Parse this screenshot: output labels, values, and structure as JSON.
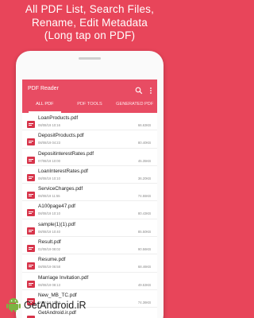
{
  "promo": {
    "line1": "All PDF List, Search Files,",
    "line2": "Rename, Edit Metadata",
    "line3": "(Long tap on PDF)"
  },
  "appbar": {
    "title": "PDF Reader",
    "icons": [
      "search-icon",
      "more-vert-icon"
    ]
  },
  "tabs": [
    {
      "label": "ALL PDF",
      "active": true
    },
    {
      "label": "PDF TOOLS",
      "active": false
    },
    {
      "label": "GENERATED PDF",
      "active": false
    }
  ],
  "files": [
    {
      "name": "LoanProducts.pdf",
      "date": "08/08/19  10:16",
      "size": "66.63KB"
    },
    {
      "name": "DepositProducts.pdf",
      "date": "08/08/19  04:23",
      "size": "80.40KB"
    },
    {
      "name": "DepositinterestRates.pdf",
      "date": "07/08/19  10:00",
      "size": "45.35KB"
    },
    {
      "name": "LoanInterestRates.pdf",
      "date": "08/08/19  10:10",
      "size": "36.20KB"
    },
    {
      "name": "ServiceCharges.pdf",
      "date": "08/08/19  11:55",
      "size": "74.55KB"
    },
    {
      "name": "A100page47.pdf",
      "date": "08/08/19  10:10",
      "size": "80.43KB"
    },
    {
      "name": "sample(1)(1).pdf",
      "date": "08/08/19  10:40",
      "size": "85.50KB"
    },
    {
      "name": "Result.pdf",
      "date": "02/08/19  08:02",
      "size": "90.56KB"
    },
    {
      "name": "Resume.pdf",
      "date": "08/08/19  06:58",
      "size": "68.46KB"
    },
    {
      "name": "Marriage Invitation.pdf",
      "date": "08/08/19  08:13",
      "size": "49.53KB"
    },
    {
      "name": "New_MB_TC.pdf",
      "date": "08/08/19  10:40",
      "size": "74.36KB"
    },
    {
      "name": "GetAndroid.ir.pdf",
      "date": "08/08/19  11:15",
      "size": "71.18KB"
    }
  ],
  "watermark": {
    "text": "GetAndroid.iR",
    "icon": "android-robot-icon"
  },
  "colors": {
    "background": "#E8455A",
    "appbar": "#E84C63",
    "pdf_icon": "#D7344A"
  }
}
